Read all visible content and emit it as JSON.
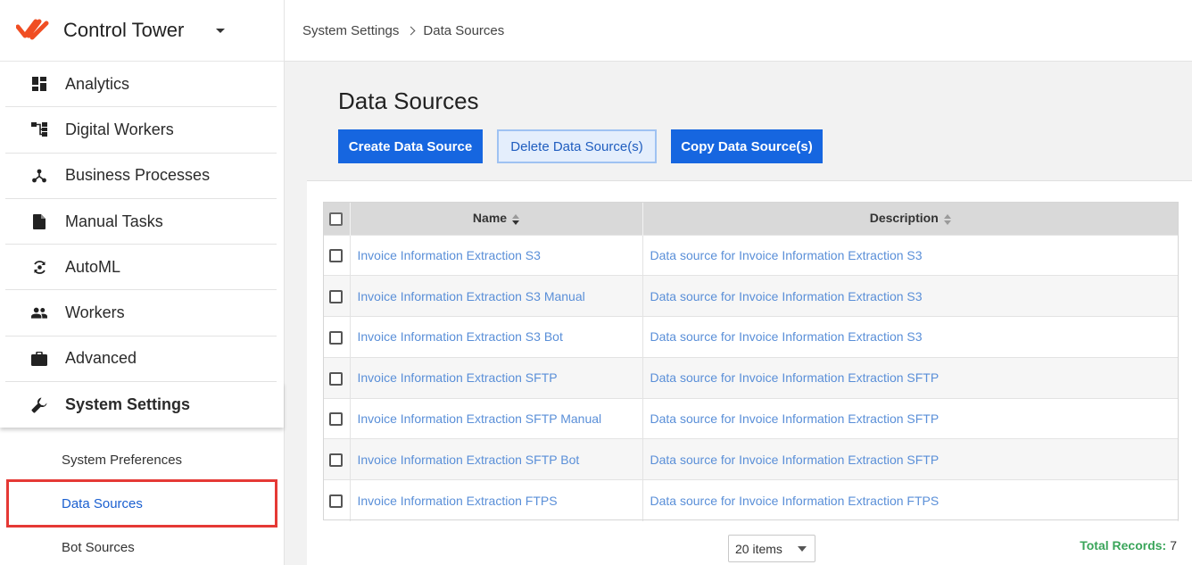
{
  "brand": {
    "title": "Control Tower",
    "logo_color": "#f04e23"
  },
  "nav": {
    "items": [
      {
        "label": "Analytics",
        "icon": "dashboard-icon"
      },
      {
        "label": "Digital Workers",
        "icon": "hierarchy-icon"
      },
      {
        "label": "Business Processes",
        "icon": "process-icon"
      },
      {
        "label": "Manual Tasks",
        "icon": "document-icon"
      },
      {
        "label": "AutoML",
        "icon": "automl-icon"
      },
      {
        "label": "Workers",
        "icon": "people-icon"
      },
      {
        "label": "Advanced",
        "icon": "briefcase-icon"
      },
      {
        "label": "System Settings",
        "icon": "wrench-icon"
      }
    ],
    "sub_items": [
      {
        "label": "System Preferences"
      },
      {
        "label": "Data Sources"
      },
      {
        "label": "Bot Sources"
      }
    ]
  },
  "breadcrumb": {
    "parent": "System Settings",
    "current": "Data Sources"
  },
  "page": {
    "title": "Data Sources",
    "buttons": {
      "create": "Create Data Source",
      "delete": "Delete Data Source(s)",
      "copy": "Copy Data Source(s)"
    }
  },
  "table": {
    "columns": {
      "name": "Name",
      "description": "Description"
    },
    "rows": [
      {
        "name": "Invoice Information Extraction S3",
        "description": "Data source for Invoice Information Extraction S3"
      },
      {
        "name": "Invoice Information Extraction S3 Manual",
        "description": "Data source for Invoice Information Extraction S3"
      },
      {
        "name": "Invoice Information Extraction S3 Bot",
        "description": "Data source for Invoice Information Extraction S3"
      },
      {
        "name": "Invoice Information Extraction SFTP",
        "description": "Data source for Invoice Information Extraction SFTP"
      },
      {
        "name": "Invoice Information Extraction SFTP Manual",
        "description": "Data source for Invoice Information Extraction SFTP"
      },
      {
        "name": "Invoice Information Extraction SFTP Bot",
        "description": "Data source for Invoice Information Extraction SFTP"
      },
      {
        "name": "Invoice Information Extraction FTPS",
        "description": "Data source for Invoice Information Extraction FTPS"
      }
    ]
  },
  "pager": {
    "page_size": "20 items"
  },
  "total": {
    "label": "Total Records:",
    "value": "7"
  },
  "colors": {
    "primary": "#1666e0",
    "link": "#5a8fd8",
    "total_label": "#3aa55a",
    "highlight": "#e53935"
  }
}
